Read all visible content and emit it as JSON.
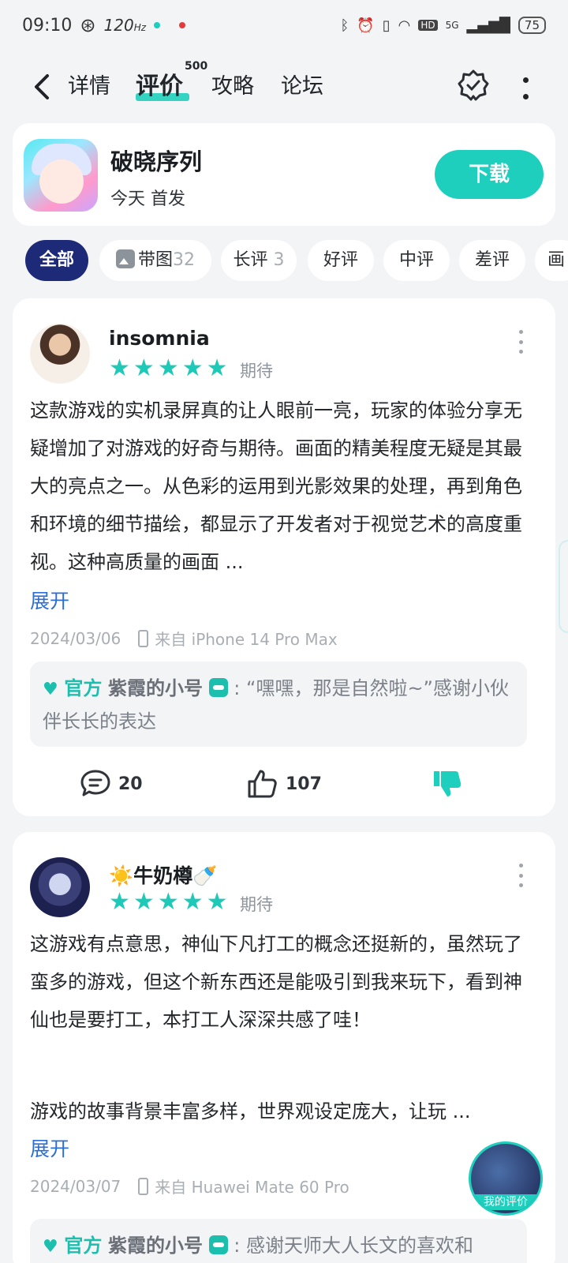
{
  "status_bar": {
    "time": "09:10",
    "refresh_rate": "120",
    "network": "5G",
    "battery": "75"
  },
  "nav": {
    "tabs": [
      {
        "label": "详情"
      },
      {
        "label": "评价",
        "badge": "500"
      },
      {
        "label": "攻略"
      },
      {
        "label": "论坛"
      }
    ]
  },
  "app": {
    "name": "破晓序列",
    "subtitle": "今天 首发",
    "download_label": "下载"
  },
  "filters": [
    {
      "label": "全部",
      "count": ""
    },
    {
      "label": "带图",
      "count": "32"
    },
    {
      "label": "长评",
      "count": "3"
    },
    {
      "label": "好评",
      "count": ""
    },
    {
      "label": "中评",
      "count": ""
    },
    {
      "label": "差评",
      "count": ""
    },
    {
      "label": "画",
      "count": ""
    }
  ],
  "reviews": [
    {
      "username": "insomnia",
      "stars": 5,
      "tag": "期待",
      "text": "这款游戏的实机录屏真的让人眼前一亮，玩家的体验分享无疑增加了对游戏的好奇与期待。画面的精美程度无疑是其最大的亮点之一。从色彩的运用到光影效果的处理，再到角色和环境的细节描绘，都显示了开发者对于视觉艺术的高度重视。这种高质量的画面 ...",
      "expand_label": "展开",
      "date": "2024/03/06",
      "device": "来自 iPhone 14 Pro Max",
      "official_tag": "官方",
      "official_name": "紫霞的小号",
      "official_reply": ": “嘿嘿，那是自然啦~”感谢小伙伴长长的表达",
      "comments": "20",
      "likes": "107"
    },
    {
      "username": "☀️牛奶樽🍼",
      "stars": 5,
      "tag": "期待",
      "text": "这游戏有点意思，神仙下凡打工的概念还挺新的，虽然玩了蛮多的游戏，但这个新东西还是能吸引到我来玩下，看到神仙也是要打工，本打工人深深共感了哇！",
      "text2": "游戏的故事背景丰富多样，世界观设定庞大，让玩 ...",
      "expand_label": "展开",
      "date": "2024/03/07",
      "device": "来自 Huawei Mate 60 Pro",
      "official_tag": "官方",
      "official_name": "紫霞的小号",
      "official_reply": ": 感谢天师大人长文的喜欢和"
    }
  ],
  "fab": {
    "label": "我的评价"
  },
  "colors": {
    "accent": "#1ecfbe",
    "chip_active": "#1d2a78",
    "link": "#2b6fd6"
  }
}
